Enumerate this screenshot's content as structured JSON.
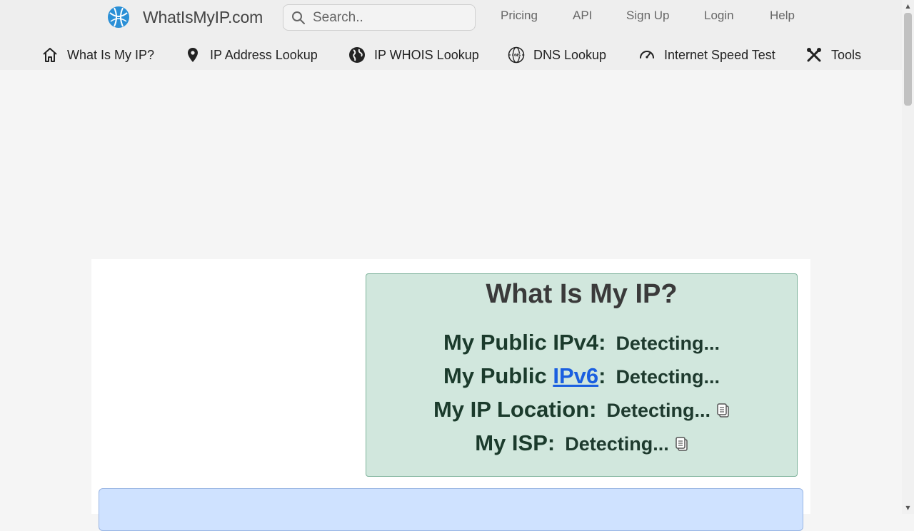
{
  "brand": {
    "name": "WhatIsMyIP.com",
    "icon": "globe-logo-icon"
  },
  "search": {
    "placeholder": "Search.."
  },
  "top_links": [
    {
      "label": "Pricing"
    },
    {
      "label": "API"
    },
    {
      "label": "Sign Up"
    },
    {
      "label": "Login"
    },
    {
      "label": "Help"
    }
  ],
  "nav": [
    {
      "label": "What Is My IP?",
      "icon": "home-icon"
    },
    {
      "label": "IP Address Lookup",
      "icon": "map-pin-icon"
    },
    {
      "label": "IP WHOIS Lookup",
      "icon": "globe-icon"
    },
    {
      "label": "DNS Lookup",
      "icon": "dns-globe-icon"
    },
    {
      "label": "Internet Speed Test",
      "icon": "speedometer-icon"
    },
    {
      "label": "Tools",
      "icon": "tools-icon"
    }
  ],
  "ip_card": {
    "title": "What Is My IP?",
    "rows": [
      {
        "label": "My Public IPv4:",
        "value": "Detecting..."
      },
      {
        "label_prefix": "My Public ",
        "label_link": "IPv6",
        "label_suffix": ":",
        "value": "Detecting..."
      },
      {
        "label": "My IP Location:",
        "value": "Detecting...",
        "icon": "copy-icon"
      },
      {
        "label": "My ISP:",
        "value": "Detecting...",
        "icon": "copy-icon"
      }
    ]
  },
  "colors": {
    "card_bg": "#d1e7dd",
    "card_border": "#7fb39c",
    "link": "#1a5fe0",
    "info_box_bg": "#cfe2ff"
  }
}
